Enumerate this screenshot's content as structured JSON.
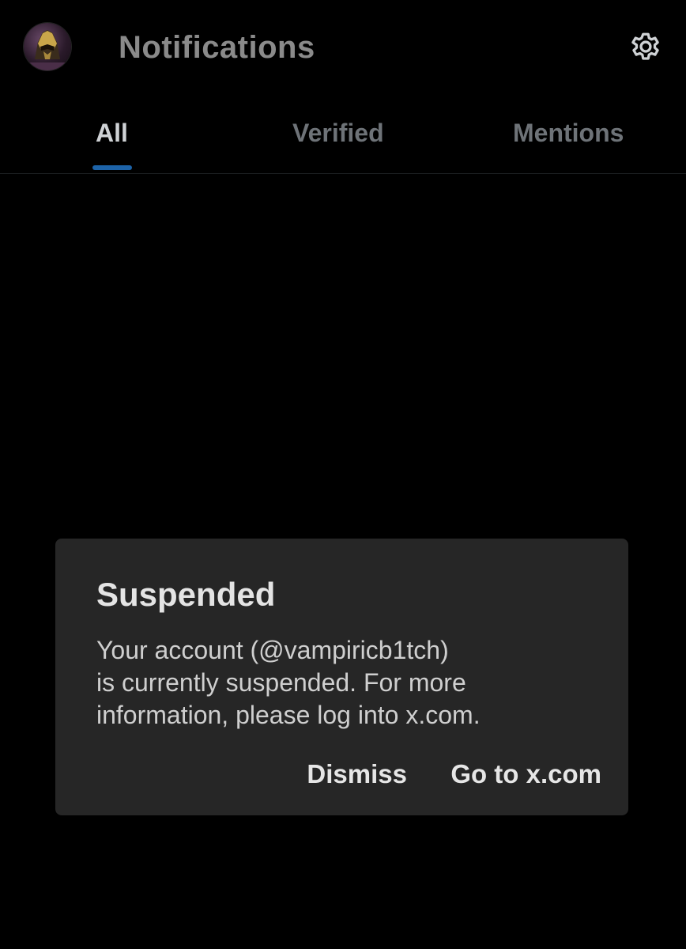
{
  "header": {
    "title": "Notifications",
    "avatar_icon": "profile-avatar",
    "settings_icon": "gear-icon"
  },
  "tabs": [
    {
      "label": "All",
      "active": true
    },
    {
      "label": "Verified",
      "active": false
    },
    {
      "label": "Mentions",
      "active": false
    }
  ],
  "colors": {
    "background": "#000000",
    "tab_indicator": "#1d63a8",
    "dialog_background": "#262626"
  },
  "dialog": {
    "title": "Suspended",
    "message_lines": [
      "Your account (@vampiricb1tch)",
      "is currently suspended. For more",
      "information, please log into x.com."
    ],
    "dismiss_label": "Dismiss",
    "goto_label": "Go to x.com"
  }
}
